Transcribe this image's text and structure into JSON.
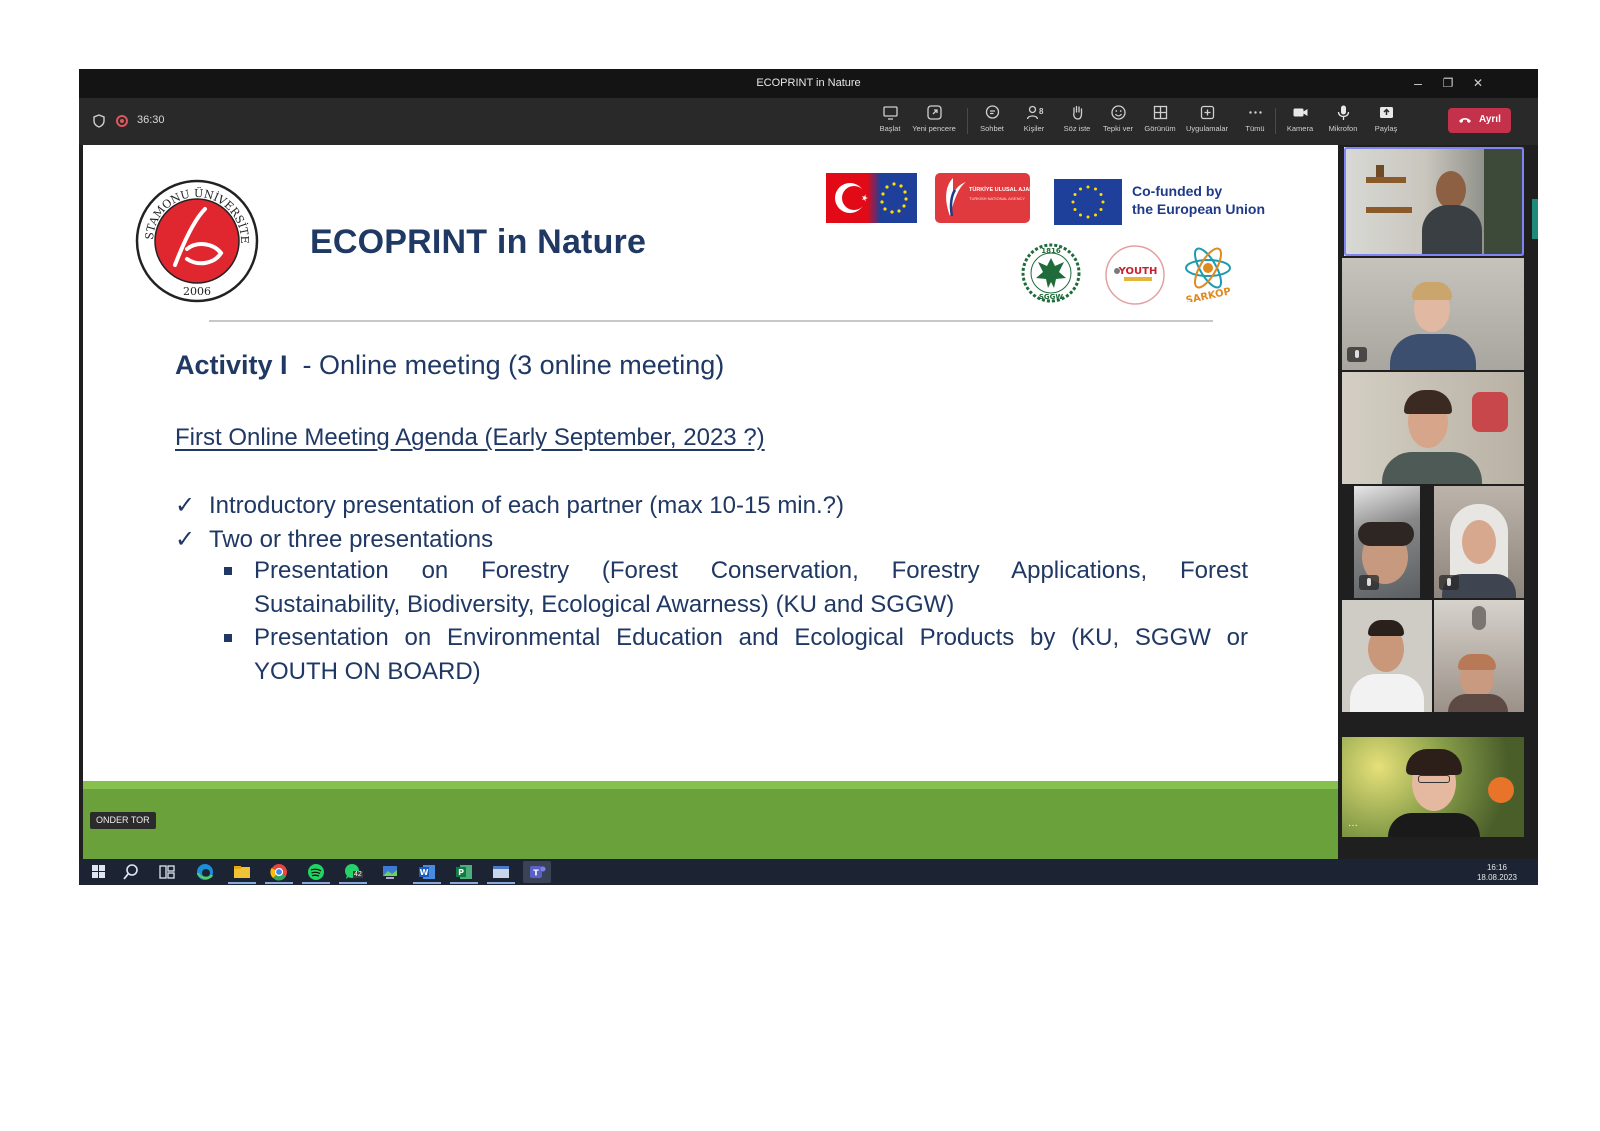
{
  "window": {
    "title": "ECOPRINT in Nature",
    "minimize": "–",
    "maximize": "❐",
    "close": "✕"
  },
  "toolbar": {
    "timer": "36:30",
    "buttons": [
      {
        "label": "Başlat",
        "icon": "cast-icon"
      },
      {
        "label": "Yeni pencere",
        "icon": "new-window-icon"
      },
      {
        "label": "Sohbet",
        "icon": "chat-icon"
      },
      {
        "label": "Kişiler",
        "icon": "people-icon",
        "badge": "8"
      },
      {
        "label": "Söz iste",
        "icon": "raise-hand-icon"
      },
      {
        "label": "Tepki ver",
        "icon": "reaction-icon"
      },
      {
        "label": "Görünüm",
        "icon": "view-grid-icon"
      },
      {
        "label": "Uygulamalar",
        "icon": "apps-icon"
      },
      {
        "label": "Tümü",
        "icon": "more-icon"
      },
      {
        "label": "Kamera",
        "icon": "camera-icon"
      },
      {
        "label": "Mikrofon",
        "icon": "microphone-icon"
      },
      {
        "label": "Paylaş",
        "icon": "share-icon"
      }
    ],
    "leave_label": "Ayrıl"
  },
  "slide": {
    "title": "ECOPRINT in Nature",
    "university_logo_text": "KASTAMONU ÜNİVERSİTESİ",
    "university_year": "2006",
    "agency_logo_text": "TÜRKİYE ULUSAL AJANSI",
    "agency_logo_subtext": "TURKISH NATIONAL AGENCY",
    "cofunded_line1": "Co-funded by",
    "cofunded_line2": "the European Union",
    "sggw_year": "1816",
    "sggw_text": "SGGW",
    "youth_text": "YOUTH",
    "sarkop_text": "SARKOP",
    "activity_bold": "Activity I",
    "activity_rest": "  - Online meeting (3 online meeting)",
    "agenda_heading": "First Online Meeting Agenda (Early September, 2023 ?)",
    "checks": [
      "Introductory presentation of each partner (max 10-15 min.?)",
      "Two or three presentations"
    ],
    "check_mark": "✓",
    "bullets": [
      {
        "line1": "Presentation on Forestry (Forest Conservation, Forestry Applications, Forest",
        "line2": "Sustainability, Biodiversity, Ecological Awarness) (KU and SGGW)"
      },
      {
        "line1": "Presentation on Environmental Education and Ecological Products by (KU, SGGW or",
        "line2": "YOUTH ON BOARD)"
      }
    ],
    "presenter_name": "ONDER TOR"
  },
  "taskbar": {
    "whatsapp_badge": "42",
    "time": "16:16",
    "date": "18.08.2023"
  },
  "colors": {
    "slide_text": "#1f3864",
    "leave_button": "#c4314b",
    "active_speaker_border": "#7f85f5",
    "green_bar": "#6aa13a"
  }
}
